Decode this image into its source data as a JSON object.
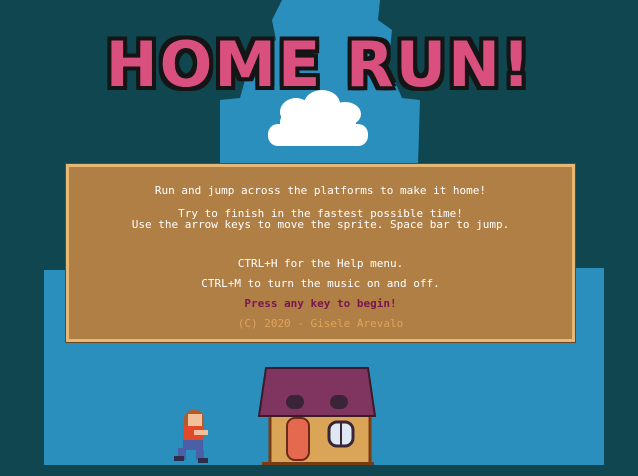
{
  "game": {
    "title": "HOME RUN!",
    "instructions": [
      "Run and jump across the platforms to make it home!",
      "Try to finish in the fastest possible time!",
      "Use the arrow keys to move the sprite. Space bar to jump.",
      "CTRL+H for the Help menu.",
      "CTRL+M to turn the music on and off.",
      "Press any key to begin!",
      "(C) 2020 - Gisele Arevalo"
    ]
  },
  "colors": {
    "background": "#0f4650",
    "silhouette": "#2b8fbd",
    "title_fill": "#d9507f",
    "panel": "#b07f46",
    "panel_border": "#e7b874",
    "prompt_text": "#7a1550",
    "credit_text": "#e1a35a"
  }
}
